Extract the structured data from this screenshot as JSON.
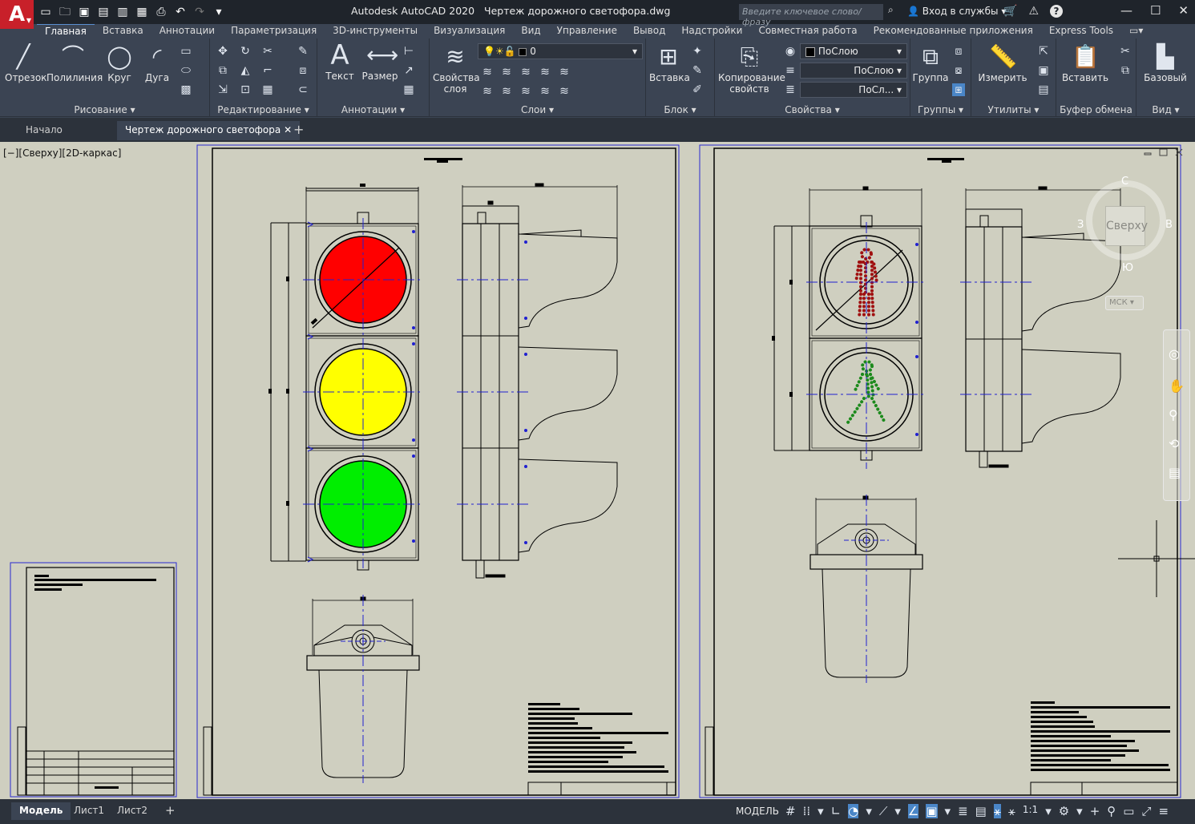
{
  "app": {
    "logo_letter": "A",
    "title": "Autodesk AutoCAD 2020",
    "file_name": "Чертеж дорожного светофора.dwg",
    "search_placeholder": "Введите ключевое слово/фразу",
    "signin": "Вход в службы"
  },
  "ribbon_tabs": [
    "Главная",
    "Вставка",
    "Аннотации",
    "Параметризация",
    "3D-инструменты",
    "Визуализация",
    "Вид",
    "Управление",
    "Вывод",
    "Надстройки",
    "Совместная работа",
    "Рекомендованные приложения",
    "Express Tools"
  ],
  "ribbon": {
    "draw": {
      "title": "Рисование",
      "line": "Отрезок",
      "polyline": "Полилиния",
      "circle": "Круг",
      "arc": "Дуга"
    },
    "modify": {
      "title": "Редактирование"
    },
    "annotation": {
      "title": "Аннотации",
      "text": "Текст",
      "dimension": "Размер"
    },
    "layers": {
      "title": "Слои",
      "layer_props_1": "Свойства",
      "layer_props_2": "слоя",
      "current_layer": "0"
    },
    "block": {
      "title": "Блок",
      "insert": "Вставка"
    },
    "properties": {
      "title": "Свойства",
      "match_1": "Копирование",
      "match_2": "свойств",
      "color": "ПоСлою",
      "linetype": "ПоСлою",
      "lineweight": "ПоСл..."
    },
    "groups": {
      "title": "Группы",
      "group": "Группа"
    },
    "utilities": {
      "title": "Утилиты",
      "measure": "Измерить"
    },
    "clipboard": {
      "title": "Буфер обмена",
      "paste": "Вставить"
    },
    "view": {
      "title": "Вид",
      "base": "Базовый"
    }
  },
  "doc_tabs": {
    "start": "Начало",
    "active": "Чертеж дорожного светофора"
  },
  "viewport": {
    "label": "[−][Сверху][2D-каркас]",
    "viewcube": {
      "face": "Сверху",
      "north": "С",
      "south": "Ю",
      "west": "З",
      "east": "В"
    },
    "ucs": "МСК"
  },
  "layout_tabs": [
    "Модель",
    "Лист1",
    "Лист2"
  ],
  "status": {
    "mode": "МОДЕЛЬ",
    "scale": "1:1"
  },
  "colors": {
    "red_lamp": "#ff0000",
    "yellow_lamp": "#ffff00",
    "green_lamp": "#00ee00",
    "ped_red": "#a01010",
    "ped_green": "#1c8a1c",
    "center_line": "#2020d0",
    "paper": "#cfcfc0"
  }
}
